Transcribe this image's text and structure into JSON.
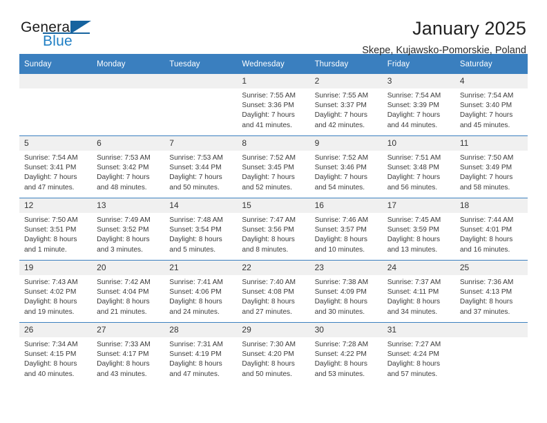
{
  "logo": {
    "general": "General",
    "blue": "Blue",
    "triangle_color": "#16639f",
    "blue_color": "#1f7fc4"
  },
  "header": {
    "title": "January 2025",
    "subtitle": "Skepe, Kujawsko-Pomorskie, Poland"
  },
  "theme": {
    "header_bg": "#3a7fbf",
    "daynum_bg": "#f0f0f0",
    "row_border": "#3a7fbf"
  },
  "weekday_headers": [
    "Sunday",
    "Monday",
    "Tuesday",
    "Wednesday",
    "Thursday",
    "Friday",
    "Saturday"
  ],
  "weeks": [
    [
      {
        "day": "",
        "sunrise": "",
        "sunset": "",
        "daylight1": "",
        "daylight2": "",
        "empty": true
      },
      {
        "day": "",
        "sunrise": "",
        "sunset": "",
        "daylight1": "",
        "daylight2": "",
        "empty": true
      },
      {
        "day": "",
        "sunrise": "",
        "sunset": "",
        "daylight1": "",
        "daylight2": "",
        "empty": true
      },
      {
        "day": "1",
        "sunrise": "Sunrise: 7:55 AM",
        "sunset": "Sunset: 3:36 PM",
        "daylight1": "Daylight: 7 hours",
        "daylight2": "and 41 minutes."
      },
      {
        "day": "2",
        "sunrise": "Sunrise: 7:55 AM",
        "sunset": "Sunset: 3:37 PM",
        "daylight1": "Daylight: 7 hours",
        "daylight2": "and 42 minutes."
      },
      {
        "day": "3",
        "sunrise": "Sunrise: 7:54 AM",
        "sunset": "Sunset: 3:39 PM",
        "daylight1": "Daylight: 7 hours",
        "daylight2": "and 44 minutes."
      },
      {
        "day": "4",
        "sunrise": "Sunrise: 7:54 AM",
        "sunset": "Sunset: 3:40 PM",
        "daylight1": "Daylight: 7 hours",
        "daylight2": "and 45 minutes."
      }
    ],
    [
      {
        "day": "5",
        "sunrise": "Sunrise: 7:54 AM",
        "sunset": "Sunset: 3:41 PM",
        "daylight1": "Daylight: 7 hours",
        "daylight2": "and 47 minutes."
      },
      {
        "day": "6",
        "sunrise": "Sunrise: 7:53 AM",
        "sunset": "Sunset: 3:42 PM",
        "daylight1": "Daylight: 7 hours",
        "daylight2": "and 48 minutes."
      },
      {
        "day": "7",
        "sunrise": "Sunrise: 7:53 AM",
        "sunset": "Sunset: 3:44 PM",
        "daylight1": "Daylight: 7 hours",
        "daylight2": "and 50 minutes."
      },
      {
        "day": "8",
        "sunrise": "Sunrise: 7:52 AM",
        "sunset": "Sunset: 3:45 PM",
        "daylight1": "Daylight: 7 hours",
        "daylight2": "and 52 minutes."
      },
      {
        "day": "9",
        "sunrise": "Sunrise: 7:52 AM",
        "sunset": "Sunset: 3:46 PM",
        "daylight1": "Daylight: 7 hours",
        "daylight2": "and 54 minutes."
      },
      {
        "day": "10",
        "sunrise": "Sunrise: 7:51 AM",
        "sunset": "Sunset: 3:48 PM",
        "daylight1": "Daylight: 7 hours",
        "daylight2": "and 56 minutes."
      },
      {
        "day": "11",
        "sunrise": "Sunrise: 7:50 AM",
        "sunset": "Sunset: 3:49 PM",
        "daylight1": "Daylight: 7 hours",
        "daylight2": "and 58 minutes."
      }
    ],
    [
      {
        "day": "12",
        "sunrise": "Sunrise: 7:50 AM",
        "sunset": "Sunset: 3:51 PM",
        "daylight1": "Daylight: 8 hours",
        "daylight2": "and 1 minute."
      },
      {
        "day": "13",
        "sunrise": "Sunrise: 7:49 AM",
        "sunset": "Sunset: 3:52 PM",
        "daylight1": "Daylight: 8 hours",
        "daylight2": "and 3 minutes."
      },
      {
        "day": "14",
        "sunrise": "Sunrise: 7:48 AM",
        "sunset": "Sunset: 3:54 PM",
        "daylight1": "Daylight: 8 hours",
        "daylight2": "and 5 minutes."
      },
      {
        "day": "15",
        "sunrise": "Sunrise: 7:47 AM",
        "sunset": "Sunset: 3:56 PM",
        "daylight1": "Daylight: 8 hours",
        "daylight2": "and 8 minutes."
      },
      {
        "day": "16",
        "sunrise": "Sunrise: 7:46 AM",
        "sunset": "Sunset: 3:57 PM",
        "daylight1": "Daylight: 8 hours",
        "daylight2": "and 10 minutes."
      },
      {
        "day": "17",
        "sunrise": "Sunrise: 7:45 AM",
        "sunset": "Sunset: 3:59 PM",
        "daylight1": "Daylight: 8 hours",
        "daylight2": "and 13 minutes."
      },
      {
        "day": "18",
        "sunrise": "Sunrise: 7:44 AM",
        "sunset": "Sunset: 4:01 PM",
        "daylight1": "Daylight: 8 hours",
        "daylight2": "and 16 minutes."
      }
    ],
    [
      {
        "day": "19",
        "sunrise": "Sunrise: 7:43 AM",
        "sunset": "Sunset: 4:02 PM",
        "daylight1": "Daylight: 8 hours",
        "daylight2": "and 19 minutes."
      },
      {
        "day": "20",
        "sunrise": "Sunrise: 7:42 AM",
        "sunset": "Sunset: 4:04 PM",
        "daylight1": "Daylight: 8 hours",
        "daylight2": "and 21 minutes."
      },
      {
        "day": "21",
        "sunrise": "Sunrise: 7:41 AM",
        "sunset": "Sunset: 4:06 PM",
        "daylight1": "Daylight: 8 hours",
        "daylight2": "and 24 minutes."
      },
      {
        "day": "22",
        "sunrise": "Sunrise: 7:40 AM",
        "sunset": "Sunset: 4:08 PM",
        "daylight1": "Daylight: 8 hours",
        "daylight2": "and 27 minutes."
      },
      {
        "day": "23",
        "sunrise": "Sunrise: 7:38 AM",
        "sunset": "Sunset: 4:09 PM",
        "daylight1": "Daylight: 8 hours",
        "daylight2": "and 30 minutes."
      },
      {
        "day": "24",
        "sunrise": "Sunrise: 7:37 AM",
        "sunset": "Sunset: 4:11 PM",
        "daylight1": "Daylight: 8 hours",
        "daylight2": "and 34 minutes."
      },
      {
        "day": "25",
        "sunrise": "Sunrise: 7:36 AM",
        "sunset": "Sunset: 4:13 PM",
        "daylight1": "Daylight: 8 hours",
        "daylight2": "and 37 minutes."
      }
    ],
    [
      {
        "day": "26",
        "sunrise": "Sunrise: 7:34 AM",
        "sunset": "Sunset: 4:15 PM",
        "daylight1": "Daylight: 8 hours",
        "daylight2": "and 40 minutes."
      },
      {
        "day": "27",
        "sunrise": "Sunrise: 7:33 AM",
        "sunset": "Sunset: 4:17 PM",
        "daylight1": "Daylight: 8 hours",
        "daylight2": "and 43 minutes."
      },
      {
        "day": "28",
        "sunrise": "Sunrise: 7:31 AM",
        "sunset": "Sunset: 4:19 PM",
        "daylight1": "Daylight: 8 hours",
        "daylight2": "and 47 minutes."
      },
      {
        "day": "29",
        "sunrise": "Sunrise: 7:30 AM",
        "sunset": "Sunset: 4:20 PM",
        "daylight1": "Daylight: 8 hours",
        "daylight2": "and 50 minutes."
      },
      {
        "day": "30",
        "sunrise": "Sunrise: 7:28 AM",
        "sunset": "Sunset: 4:22 PM",
        "daylight1": "Daylight: 8 hours",
        "daylight2": "and 53 minutes."
      },
      {
        "day": "31",
        "sunrise": "Sunrise: 7:27 AM",
        "sunset": "Sunset: 4:24 PM",
        "daylight1": "Daylight: 8 hours",
        "daylight2": "and 57 minutes."
      },
      {
        "day": "",
        "sunrise": "",
        "sunset": "",
        "daylight1": "",
        "daylight2": "",
        "empty": true
      }
    ]
  ]
}
